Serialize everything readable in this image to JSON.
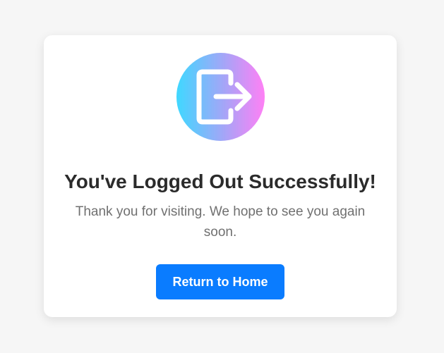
{
  "logout_card": {
    "icon": "logout-arrow-icon",
    "title": "You've Logged Out Successfully!",
    "message": "Thank you for visiting. We hope to see you again soon.",
    "button_label": "Return to Home"
  },
  "colors": {
    "background": "#f6f6f6",
    "card": "#ffffff",
    "button": "#0a7cff",
    "gradient_start": "#3fd8ff",
    "gradient_end": "#ff80f5",
    "title_text": "#2b2b2b",
    "message_text": "#707070"
  }
}
